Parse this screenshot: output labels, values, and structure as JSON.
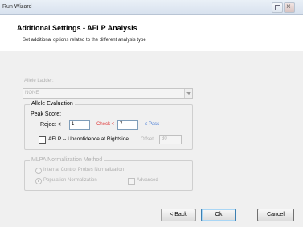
{
  "window": {
    "title": "Run Wizard"
  },
  "header": {
    "title": "Addtional Settings - AFLP Analysis",
    "subtitle": "Set additional options related to the different analysis type"
  },
  "allele_ladder": {
    "label": "Allele Ladder:",
    "value": "NONE"
  },
  "allele_evaluation": {
    "legend": "Allele Evaluation",
    "peak_score_label": "Peak Score:",
    "reject_label": "Reject <",
    "reject_value": "1",
    "check_label": "Check <",
    "check_value": "7",
    "pass_label": "≤ Pass",
    "aflp_checkbox_label": "AFLP -- Unconfidence at Rightside",
    "offset_label": "Offset:",
    "offset_value": "30"
  },
  "mlpa": {
    "legend": "MLPA Normalization Method",
    "option_internal": "Internal Control Probes Normalization",
    "option_population": "Population Normalization",
    "advanced_label": "Advanced"
  },
  "buttons": {
    "back": "< Back",
    "ok": "Ok",
    "cancel": "Cancel"
  }
}
